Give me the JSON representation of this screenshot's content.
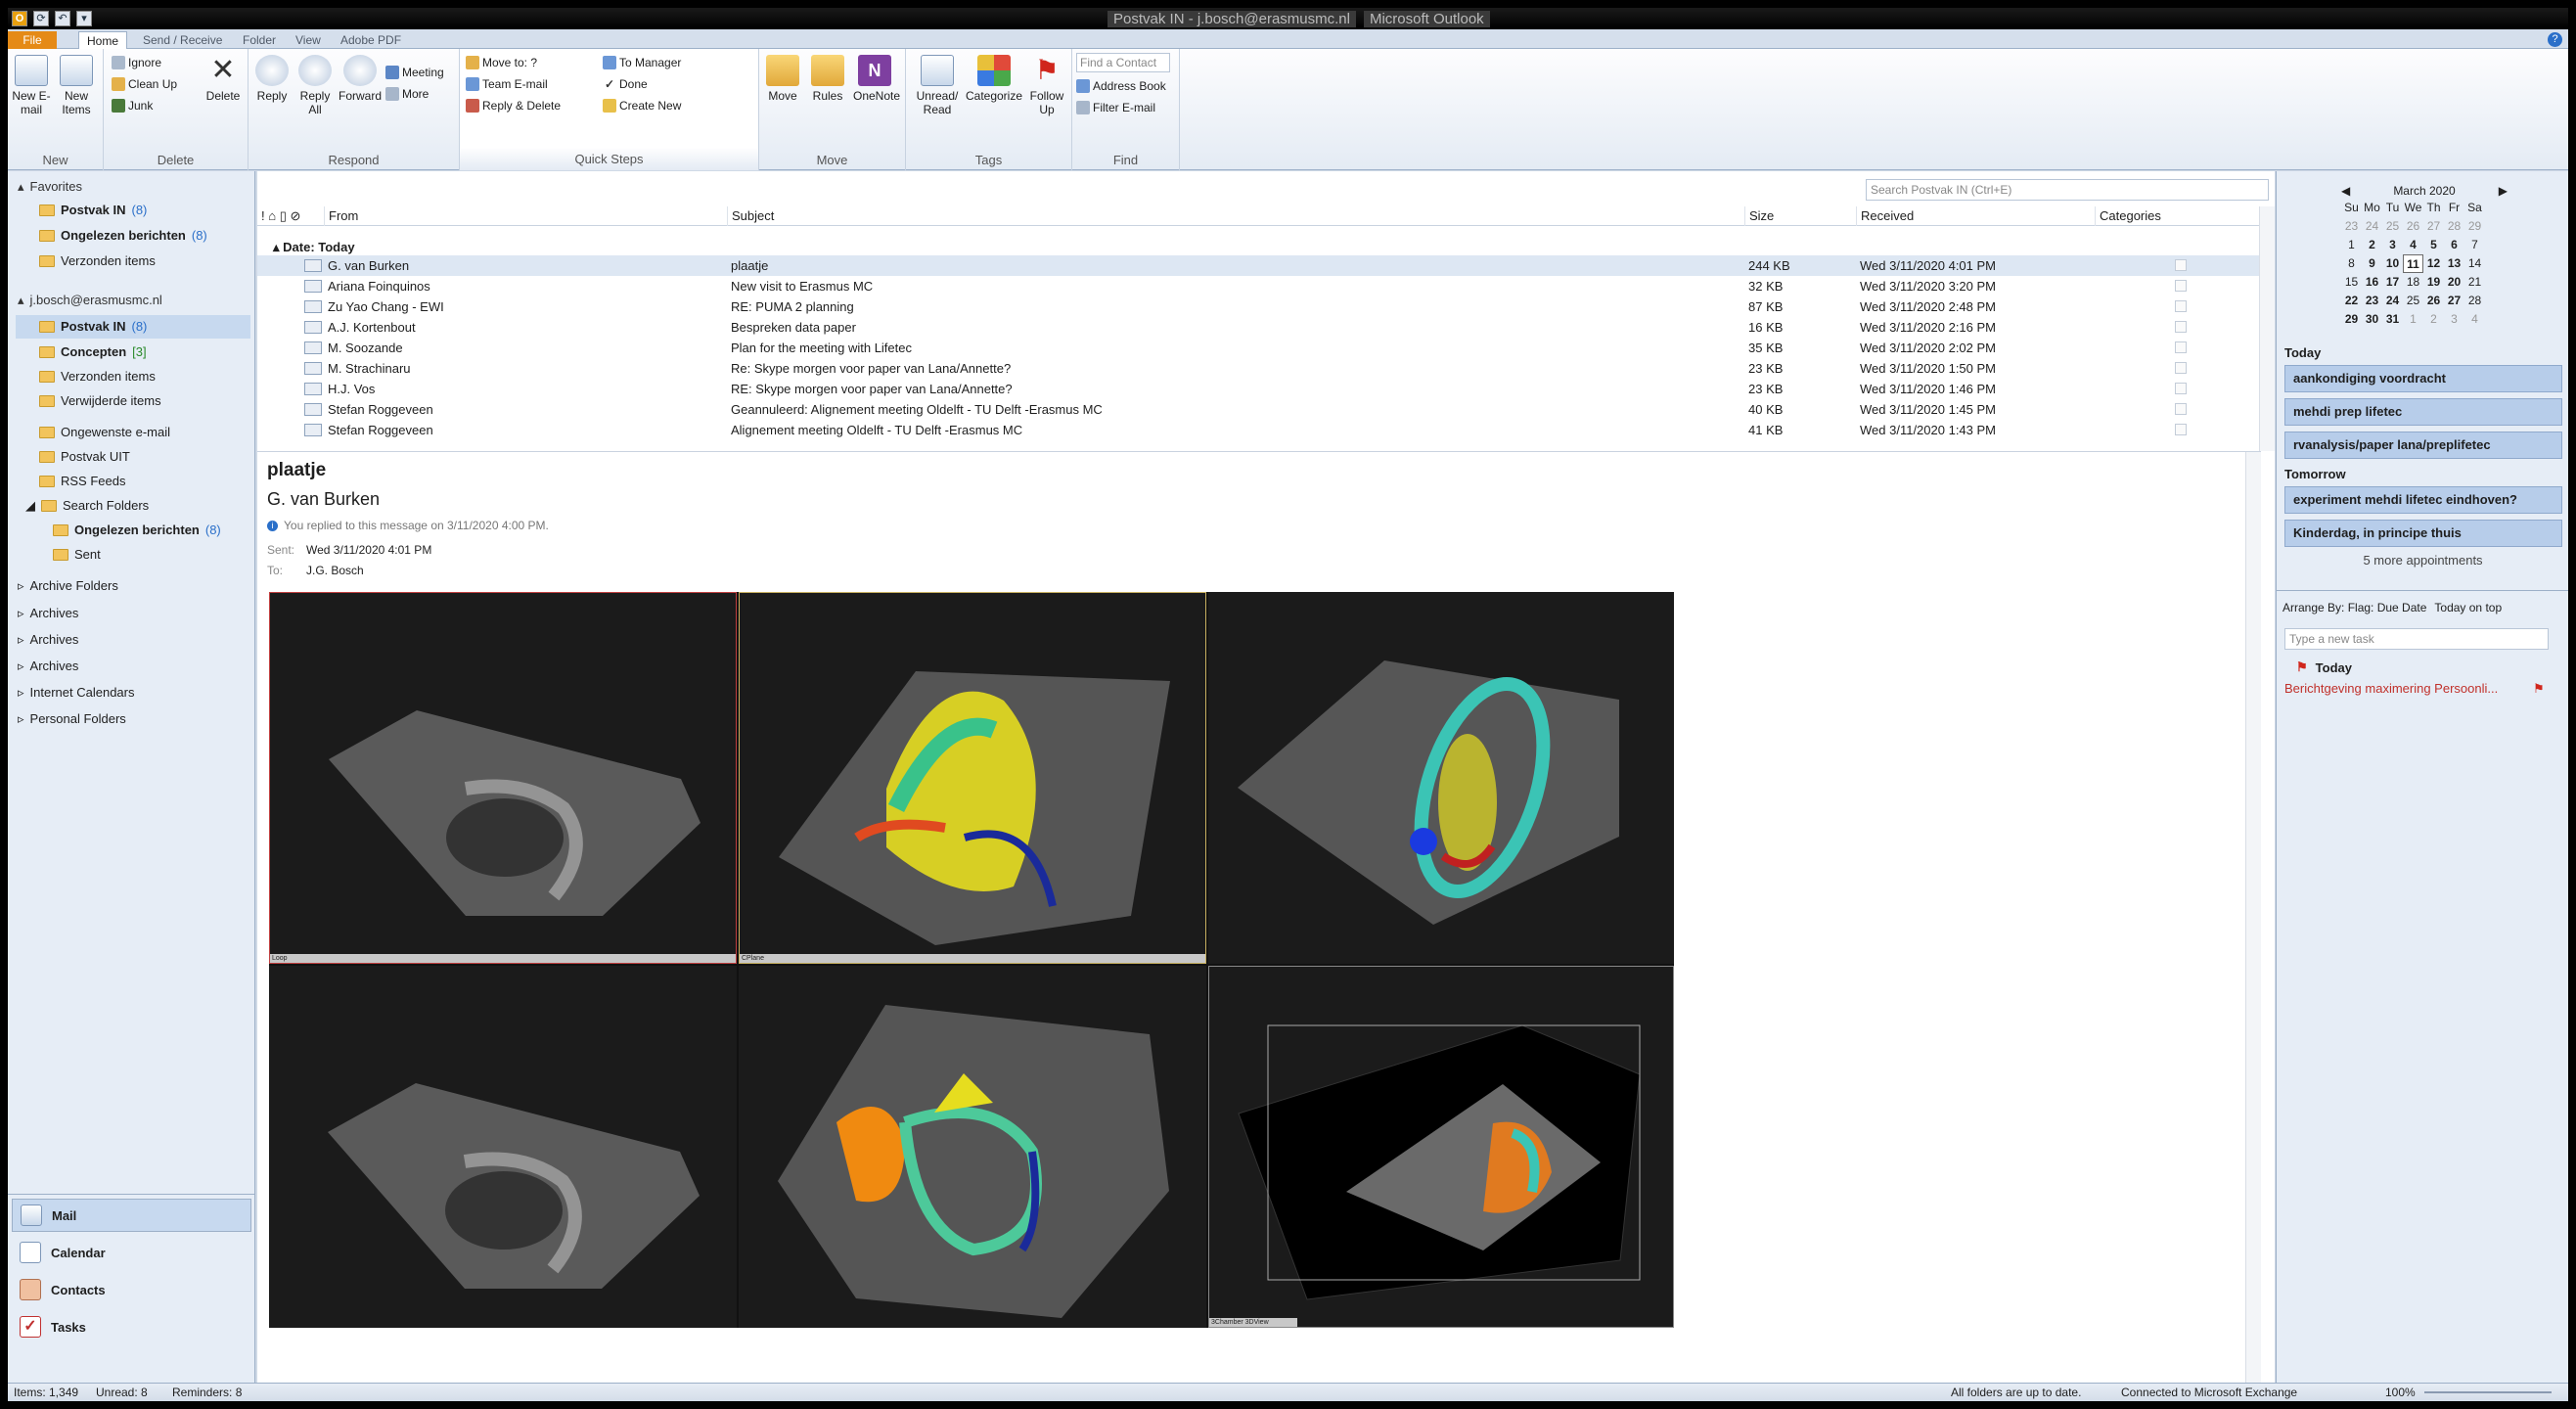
{
  "titlebar": {
    "folder_title": "Postvak IN - j.bosch@erasmusmc.nl",
    "app_title": "Microsoft Outlook"
  },
  "tabs": [
    "File",
    "Home",
    "Send / Receive",
    "Folder",
    "View",
    "Adobe PDF"
  ],
  "ribbon": {
    "new": {
      "new_email": "New E-mail",
      "new_items": "New Items",
      "label": "New"
    },
    "delete": {
      "ignore": "Ignore",
      "cleanup": "Clean Up",
      "junk": "Junk",
      "delete": "Delete",
      "label": "Delete"
    },
    "respond": {
      "reply": "Reply",
      "reply_all": "Reply All",
      "forward": "Forward",
      "meeting": "Meeting",
      "more": "More",
      "label": "Respond"
    },
    "quicksteps": {
      "move_to": "Move to: ?",
      "team_email": "Team E-mail",
      "reply_delete": "Reply & Delete",
      "to_manager": "To Manager",
      "done": "Done",
      "create_new": "Create New",
      "label": "Quick Steps"
    },
    "move": {
      "move": "Move",
      "rules": "Rules",
      "onenote": "OneNote",
      "label": "Move"
    },
    "tags": {
      "unread_read": "Unread/ Read",
      "categorize": "Categorize",
      "follow_up": "Follow Up",
      "label": "Tags"
    },
    "find": {
      "find_contact": "Find a Contact",
      "address_book": "Address Book",
      "filter_email": "Filter E-mail",
      "label": "Find"
    }
  },
  "nav": {
    "favorites": "Favorites",
    "fav_items": [
      {
        "label": "Postvak IN",
        "count": "(8)"
      },
      {
        "label": "Ongelezen berichten",
        "count": "(8)"
      },
      {
        "label": "Verzonden items",
        "count": ""
      }
    ],
    "account": "j.bosch@erasmusmc.nl",
    "acct_items": [
      {
        "label": "Postvak IN",
        "count": "(8)"
      },
      {
        "label": "Concepten",
        "count": "[3]"
      },
      {
        "label": "Verzonden items",
        "count": ""
      },
      {
        "label": "Verwijderde items",
        "count": ""
      },
      {
        "label": "Ongewenste e-mail",
        "count": ""
      },
      {
        "label": "Postvak UIT",
        "count": ""
      },
      {
        "label": "RSS Feeds",
        "count": ""
      },
      {
        "label": "Search Folders",
        "count": ""
      },
      {
        "label": "Ongelezen berichten",
        "count": "(8)"
      },
      {
        "label": "Sent",
        "count": ""
      }
    ],
    "other": [
      "Archive Folders",
      "Archives",
      "Archives",
      "Archives",
      "Internet Calendars",
      "Personal Folders"
    ],
    "bottom": [
      "Mail",
      "Calendar",
      "Contacts",
      "Tasks"
    ]
  },
  "search": {
    "placeholder": "Search Postvak IN (Ctrl+E)"
  },
  "columns": {
    "from": "From",
    "subject": "Subject",
    "size": "Size",
    "received": "Received",
    "categories": "Categories"
  },
  "date_group": "Date: Today",
  "messages": [
    {
      "from": "G. van Burken",
      "subject": "plaatje",
      "size": "244 KB",
      "received": "Wed 3/11/2020 4:01 PM"
    },
    {
      "from": "Ariana Foinquinos",
      "subject": "New visit to Erasmus MC",
      "size": "32 KB",
      "received": "Wed 3/11/2020 3:20 PM"
    },
    {
      "from": "Zu Yao Chang - EWI",
      "subject": "RE: PUMA 2 planning",
      "size": "87 KB",
      "received": "Wed 3/11/2020 2:48 PM"
    },
    {
      "from": "A.J. Kortenbout",
      "subject": "Bespreken data paper",
      "size": "16 KB",
      "received": "Wed 3/11/2020 2:16 PM"
    },
    {
      "from": "M. Soozande",
      "subject": "Plan for the meeting with Lifetec",
      "size": "35 KB",
      "received": "Wed 3/11/2020 2:02 PM"
    },
    {
      "from": "M. Strachinaru",
      "subject": "Re: Skype morgen voor paper van Lana/Annette?",
      "size": "23 KB",
      "received": "Wed 3/11/2020 1:50 PM"
    },
    {
      "from": "H.J. Vos",
      "subject": "RE: Skype morgen voor paper van Lana/Annette?",
      "size": "23 KB",
      "received": "Wed 3/11/2020 1:46 PM"
    },
    {
      "from": "Stefan Roggeveen",
      "subject": "Geannuleerd: Alignement meeting Oldelft - TU Delft -Erasmus MC",
      "size": "40 KB",
      "received": "Wed 3/11/2020 1:45 PM"
    },
    {
      "from": "Stefan Roggeveen",
      "subject": "Alignement meeting Oldelft - TU Delft -Erasmus MC",
      "size": "41 KB",
      "received": "Wed 3/11/2020 1:43 PM"
    }
  ],
  "reading": {
    "subject": "plaatje",
    "from": "G. van Burken",
    "info": "You replied to this message on 3/11/2020 4:00 PM.",
    "sent_label": "Sent:",
    "sent": "Wed 3/11/2020 4:01 PM",
    "to_label": "To:",
    "to": "J.G. Bosch",
    "panel_tags": [
      "Loop",
      "CPlane",
      "3Chamber",
      "3DView"
    ]
  },
  "calendar": {
    "month": "March 2020",
    "days": [
      "Su",
      "Mo",
      "Tu",
      "We",
      "Th",
      "Fr",
      "Sa"
    ],
    "weeks": [
      [
        "23",
        "24",
        "25",
        "26",
        "27",
        "28",
        "29"
      ],
      [
        "1",
        "2",
        "3",
        "4",
        "5",
        "6",
        "7"
      ],
      [
        "8",
        "9",
        "10",
        "11",
        "12",
        "13",
        "14"
      ],
      [
        "15",
        "16",
        "17",
        "18",
        "19",
        "20",
        "21"
      ],
      [
        "22",
        "23",
        "24",
        "25",
        "26",
        "27",
        "28"
      ],
      [
        "29",
        "30",
        "31",
        "1",
        "2",
        "3",
        "4"
      ]
    ]
  },
  "todo": {
    "today": "Today",
    "today_appts": [
      "aankondiging voordracht",
      "mehdi prep lifetec",
      "rvanalysis/paper lana/preplifetec"
    ],
    "tomorrow": "Tomorrow",
    "tomorrow_appts": [
      "experiment mehdi lifetec eindhoven?",
      "Kinderdag, in principe thuis"
    ],
    "more": "5 more appointments",
    "arrange": "Arrange By: Flag: Due Date",
    "order": "Today on top",
    "new_task": "Type a new task",
    "task_group": "Today",
    "task": "Berichtgeving maximering Persoonli..."
  },
  "status": {
    "items": "Items: 1,349",
    "unread": "Unread: 8",
    "reminders": "Reminders: 8",
    "uptodate": "All folders are up to date.",
    "connected": "Connected to Microsoft Exchange",
    "zoom": "100%"
  }
}
